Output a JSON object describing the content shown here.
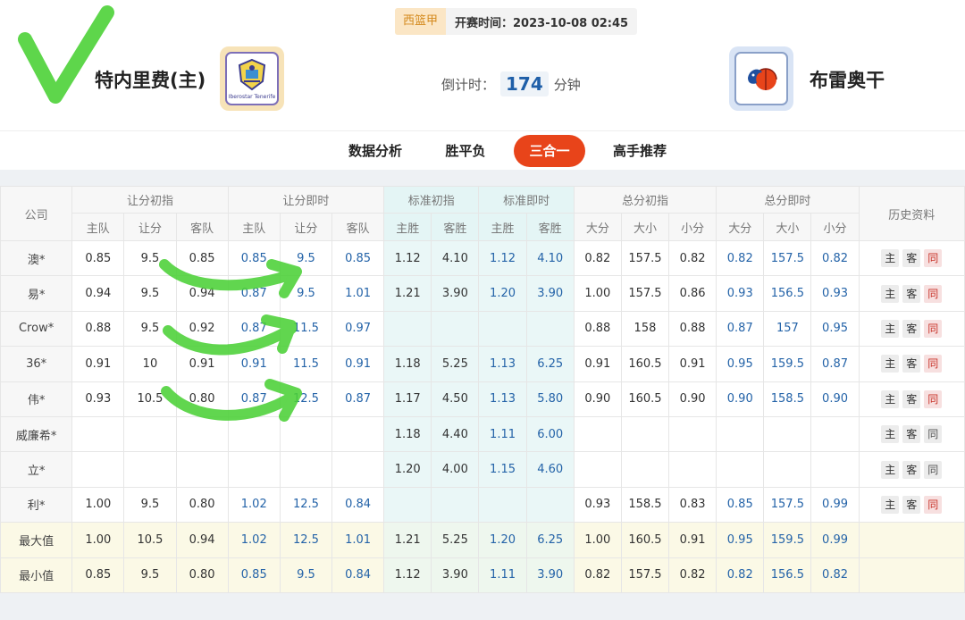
{
  "match": {
    "league": "西篮甲",
    "start_time": "开赛时间：2023-10-08 02:45",
    "home_team": "特内里费(主)",
    "away_team": "布雷奥干",
    "home_logo_text": "Iberostar Tenerife",
    "countdown_label": "倒计时：",
    "countdown_value": "174",
    "countdown_unit": "分钟"
  },
  "tabs": [
    {
      "label": "数据分析",
      "active": false
    },
    {
      "label": "胜平负",
      "active": false
    },
    {
      "label": "三合一",
      "active": true
    },
    {
      "label": "高手推荐",
      "active": false
    }
  ],
  "table": {
    "company_header": "公司",
    "history_header": "历史资料",
    "groups": [
      "让分初指",
      "让分即时",
      "标准初指",
      "标准即时",
      "总分初指",
      "总分即时"
    ],
    "subheaders": [
      "主队",
      "让分",
      "客队",
      "主队",
      "让分",
      "客队",
      "主胜",
      "客胜",
      "主胜",
      "客胜",
      "大分",
      "大小",
      "小分",
      "大分",
      "大小",
      "小分"
    ],
    "history_buttons": [
      "主",
      "客",
      "同"
    ],
    "rows": [
      {
        "company": "澳*",
        "cells": [
          "0.85",
          "9.5",
          "0.85",
          "0.85",
          "9.5",
          "0.85",
          "1.12",
          "4.10",
          "1.12",
          "4.10",
          "0.82",
          "157.5",
          "0.82",
          "0.82",
          "157.5",
          "0.82"
        ],
        "same_red": true
      },
      {
        "company": "易*",
        "cells": [
          "0.94",
          "9.5",
          "0.94",
          "0.87",
          "9.5",
          "1.01",
          "1.21",
          "3.90",
          "1.20",
          "3.90",
          "1.00",
          "157.5",
          "0.86",
          "0.93",
          "156.5",
          "0.93"
        ],
        "same_red": true
      },
      {
        "company": "Crow*",
        "cells": [
          "0.88",
          "9.5",
          "0.92",
          "0.87",
          "11.5",
          "0.97",
          "",
          "",
          "",
          "",
          "0.88",
          "158",
          "0.88",
          "0.87",
          "157",
          "0.95"
        ],
        "same_red": true
      },
      {
        "company": "36*",
        "cells": [
          "0.91",
          "10",
          "0.91",
          "0.91",
          "11.5",
          "0.91",
          "1.18",
          "5.25",
          "1.13",
          "6.25",
          "0.91",
          "160.5",
          "0.91",
          "0.95",
          "159.5",
          "0.87"
        ],
        "same_red": true
      },
      {
        "company": "伟*",
        "cells": [
          "0.93",
          "10.5",
          "0.80",
          "0.87",
          "12.5",
          "0.87",
          "1.17",
          "4.50",
          "1.13",
          "5.80",
          "0.90",
          "160.5",
          "0.90",
          "0.90",
          "158.5",
          "0.90"
        ],
        "same_red": true
      },
      {
        "company": "威廉希*",
        "cells": [
          "",
          "",
          "",
          "",
          "",
          "",
          "1.18",
          "4.40",
          "1.11",
          "6.00",
          "",
          "",
          "",
          "",
          "",
          ""
        ],
        "same_red": false
      },
      {
        "company": "立*",
        "cells": [
          "",
          "",
          "",
          "",
          "",
          "",
          "1.20",
          "4.00",
          "1.15",
          "4.60",
          "",
          "",
          "",
          "",
          "",
          ""
        ],
        "same_red": false
      },
      {
        "company": "利*",
        "cells": [
          "1.00",
          "9.5",
          "0.80",
          "1.02",
          "12.5",
          "0.84",
          "",
          "",
          "",
          "",
          "0.93",
          "158.5",
          "0.83",
          "0.85",
          "157.5",
          "0.99"
        ],
        "same_red": true
      }
    ],
    "summary": [
      {
        "label": "最大值",
        "cells": [
          "1.00",
          "10.5",
          "0.94",
          "1.02",
          "12.5",
          "1.01",
          "1.21",
          "5.25",
          "1.20",
          "6.25",
          "1.00",
          "160.5",
          "0.91",
          "0.95",
          "159.5",
          "0.99"
        ]
      },
      {
        "label": "最小值",
        "cells": [
          "0.85",
          "9.5",
          "0.80",
          "0.85",
          "9.5",
          "0.84",
          "1.12",
          "3.90",
          "1.11",
          "3.90",
          "0.82",
          "157.5",
          "0.82",
          "0.82",
          "156.5",
          "0.82"
        ]
      }
    ]
  },
  "colors": {
    "accent": "#e8441a",
    "live_value": "#2463a8",
    "annotation_green": "#4cd137"
  }
}
